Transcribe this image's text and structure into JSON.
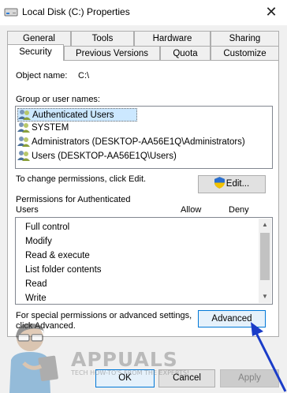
{
  "window": {
    "title": "Local Disk (C:) Properties",
    "close_glyph": "✕"
  },
  "tabs_row1": [
    "General",
    "Tools",
    "Hardware",
    "Sharing"
  ],
  "tabs_row2": [
    "Security",
    "Previous Versions",
    "Quota",
    "Customize"
  ],
  "active_tab": "Security",
  "security": {
    "object_label": "Object name:",
    "object_value": "C:\\",
    "group_label": "Group or user names:",
    "groups": [
      "Authenticated Users",
      "SYSTEM",
      "Administrators (DESKTOP-AA56E1Q\\Administrators)",
      "Users (DESKTOP-AA56E1Q\\Users)"
    ],
    "change_text": "To change permissions, click Edit.",
    "edit_button": "Edit...",
    "permissions_label_line1": "Permissions for Authenticated",
    "permissions_label_line2": "Users",
    "allow_header": "Allow",
    "deny_header": "Deny",
    "permissions": [
      "Full control",
      "Modify",
      "Read & execute",
      "List folder contents",
      "Read",
      "Write"
    ],
    "special_text_line1": "For special permissions or advanced settings,",
    "special_text_line2": "click Advanced.",
    "advanced_button": "Advanced"
  },
  "footer": {
    "ok": "OK",
    "cancel": "Cancel",
    "apply": "Apply"
  },
  "watermark": {
    "brand": "APPUALS",
    "tagline": "TECH HOW-TO'S FROM THE EXPERTS!"
  },
  "colors": {
    "accent": "#0078d7",
    "selection": "#cce8ff",
    "arrow": "#1a3cc8"
  }
}
